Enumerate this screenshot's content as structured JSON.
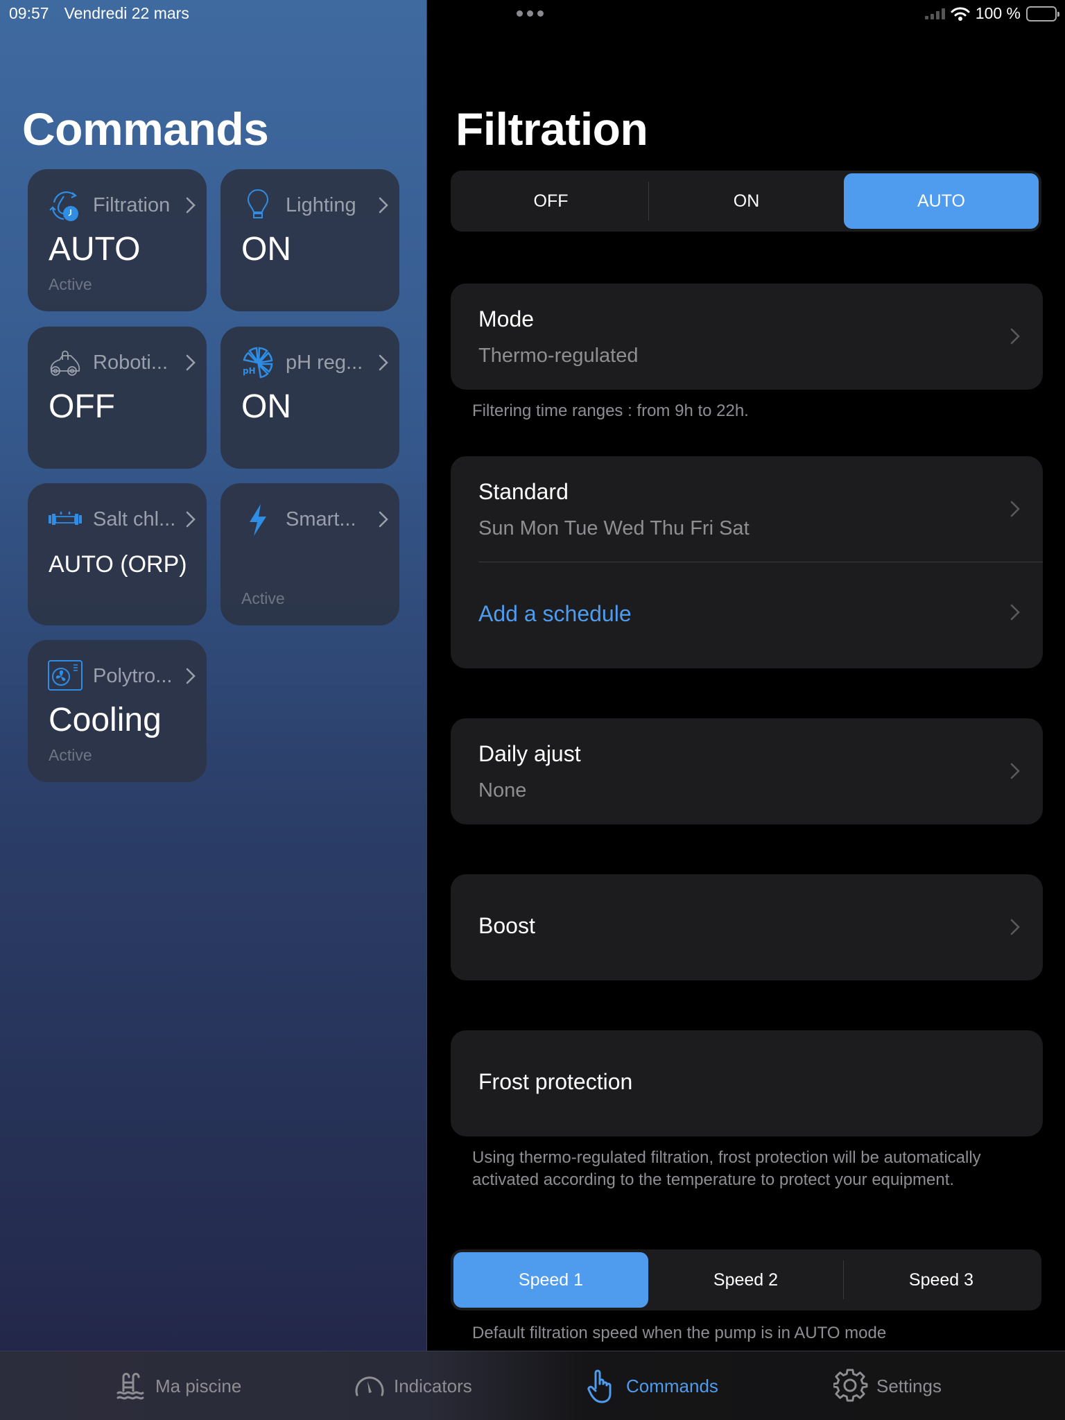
{
  "status_bar": {
    "time": "09:57",
    "date": "Vendredi 22 mars",
    "battery": "100 %"
  },
  "sidebar": {
    "title": "Commands",
    "tiles": [
      {
        "icon": "filtration-clock-icon",
        "name": "Filtration",
        "value": "AUTO",
        "sub": "Active"
      },
      {
        "icon": "lightbulb-icon",
        "name": "Lighting",
        "value": "ON",
        "sub": ""
      },
      {
        "icon": "robot-cleaner-icon",
        "name": "Roboti...",
        "value": "OFF",
        "sub": ""
      },
      {
        "icon": "ph-regulator-icon",
        "name": "pH reg...",
        "value": "ON",
        "sub": ""
      },
      {
        "icon": "salt-chlorinator-icon",
        "name": "Salt chl...",
        "value": "AUTO (ORP)",
        "sub": ""
      },
      {
        "icon": "lightning-icon",
        "name": "Smart...",
        "value": "",
        "sub": "Active"
      },
      {
        "icon": "heat-pump-fan-icon",
        "name": "Polytro...",
        "value": "Cooling",
        "sub": "Active"
      }
    ]
  },
  "detail": {
    "title": "Filtration",
    "mode_segment": {
      "options": [
        "OFF",
        "ON",
        "AUTO"
      ],
      "selected": "AUTO"
    },
    "mode_row": {
      "title": "Mode",
      "value": "Thermo-regulated"
    },
    "mode_footnote": "Filtering time ranges : from 9h to 22h.",
    "schedule_row": {
      "title": "Standard",
      "value": "Sun Mon Tue Wed Thu Fri Sat"
    },
    "add_schedule": "Add a schedule",
    "daily_row": {
      "title": "Daily ajust",
      "value": "None"
    },
    "boost_row": {
      "title": "Boost"
    },
    "frost_row": {
      "title": "Frost protection"
    },
    "frost_footnote": "Using thermo-regulated filtration, frost protection will be automatically activated according to the temperature to protect your equipment.",
    "speed_segment": {
      "options": [
        "Speed 1",
        "Speed 2",
        "Speed 3"
      ],
      "selected": "Speed 1"
    },
    "speed_footnote": "Default filtration speed when the pump is in AUTO mode"
  },
  "tabbar": {
    "tabs": [
      {
        "label": "Ma piscine",
        "icon": "pool-ladder-icon",
        "active": false
      },
      {
        "label": "Indicators",
        "icon": "gauge-icon",
        "active": false
      },
      {
        "label": "Commands",
        "icon": "hand-pointer-icon",
        "active": true
      },
      {
        "label": "Settings",
        "icon": "gear-icon",
        "active": false
      }
    ]
  },
  "colors": {
    "accent": "#4f9bee",
    "card_bg": "#1c1c1e",
    "tile_bg": "#2c3446",
    "secondary_text": "#8e8e93"
  }
}
